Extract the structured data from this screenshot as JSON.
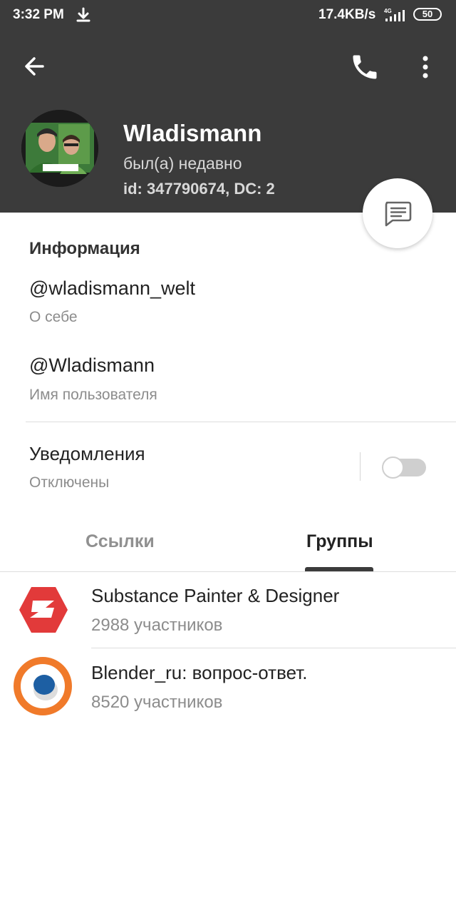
{
  "status_bar": {
    "time": "3:32 PM",
    "net_speed": "17.4KB/s",
    "network": "4G",
    "battery": "50"
  },
  "profile": {
    "name": "Wladismann",
    "status": "был(а) недавно",
    "id_line": "id: 347790674, DC: 2"
  },
  "info": {
    "title": "Информация",
    "bio_value": "@wladismann_welt",
    "bio_label": "О себе",
    "username_value": "@Wladismann",
    "username_label": "Имя пользователя",
    "notifications_title": "Уведомления",
    "notifications_state": "Отключены",
    "notifications_enabled": false
  },
  "tabs": [
    {
      "label": "Ссылки",
      "active": false
    },
    {
      "label": "Группы",
      "active": true
    }
  ],
  "groups": [
    {
      "name": "Substance Painter & Designer",
      "members": "2988 участников",
      "icon": "substance-logo-icon"
    },
    {
      "name": "Blender_ru: вопрос-ответ.",
      "members": "8520 участников",
      "icon": "blender-logo-icon"
    }
  ],
  "colors": {
    "header_bg": "#3b3b3b",
    "substance_red": "#e23a3a",
    "blender_orange": "#f07a2a",
    "blender_blue": "#1d5fa3"
  }
}
